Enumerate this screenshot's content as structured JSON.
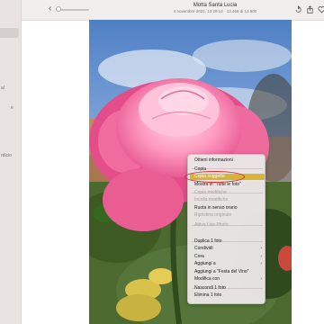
{
  "window": {
    "title": "Motta Santa Lucia",
    "subtitle": "4 novembre 2022, 13:29:12  ·  13.466 di 13.800"
  },
  "toolbar": {
    "back_icon": "chevron-left-icon",
    "zoom_level": 0.0,
    "icons": [
      "rotate-icon",
      "share-icon",
      "heart-icon"
    ]
  },
  "sidebar": {
    "fragments": [
      "al",
      "e",
      "rdicio"
    ]
  },
  "context_menu": {
    "items": [
      {
        "label": "Ottieni informazioni",
        "enabled": true
      },
      {
        "label": "Copia",
        "enabled": true
      },
      {
        "label": "Copia soggetto",
        "enabled": true,
        "highlighted": true
      },
      {
        "label": "Mostra in \"Tutte le foto\"",
        "enabled": true
      },
      {
        "label": "Copia modifiche",
        "enabled": false
      },
      {
        "label": "Incolla modifiche",
        "enabled": false
      },
      {
        "label": "Ruota in senso orario",
        "enabled": true
      },
      {
        "label": "Ripristina originale",
        "enabled": false
      },
      {
        "label": "Attiva Live Photo",
        "enabled": false
      },
      {
        "label": "Duplica 1 foto",
        "enabled": true
      },
      {
        "label": "Condividi",
        "enabled": true,
        "submenu": true
      },
      {
        "label": "Crea",
        "enabled": true,
        "submenu": true
      },
      {
        "label": "Aggiungi a",
        "enabled": true,
        "submenu": true
      },
      {
        "label": "Aggiungi a \"Festa del Vino\"",
        "enabled": true
      },
      {
        "label": "Modifica con",
        "enabled": true,
        "submenu": true
      },
      {
        "label": "Nascondi 1 foto",
        "enabled": true
      },
      {
        "label": "Elimina 1 foto",
        "enabled": true
      }
    ],
    "submenu_arrow": "›"
  },
  "colors": {
    "highlight": "#d6b43a",
    "annotation": "#e0292b",
    "rose": "#ff7fb0",
    "sky": "#6b93c9"
  }
}
